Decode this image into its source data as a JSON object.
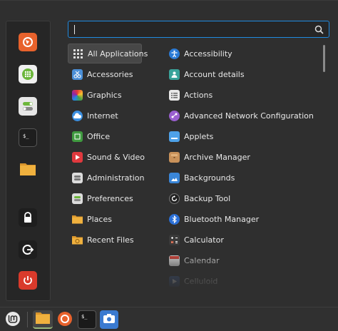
{
  "search": {
    "value": "",
    "placeholder": ""
  },
  "sidebar": {
    "items": [
      {
        "icon": "firefox-icon",
        "color": "#e8622c"
      },
      {
        "icon": "software-manager-icon",
        "color": "#6cb63a"
      },
      {
        "icon": "settings-toggle-icon",
        "color": "#e6e6e6"
      },
      {
        "icon": "terminal-icon",
        "color": "#222222"
      },
      {
        "icon": "folder-icon",
        "color": "#f0b13e"
      },
      {
        "icon": "lock-icon",
        "color": "#222222"
      },
      {
        "icon": "logout-icon",
        "color": "#222222"
      },
      {
        "icon": "power-icon",
        "color": "#d93a2b"
      }
    ]
  },
  "categories": [
    {
      "label": "All Applications",
      "icon": "grid-icon",
      "active": true
    },
    {
      "label": "Accessories",
      "icon": "scissors-icon"
    },
    {
      "label": "Graphics",
      "icon": "graphics-icon"
    },
    {
      "label": "Internet",
      "icon": "cloud-icon"
    },
    {
      "label": "Office",
      "icon": "office-icon"
    },
    {
      "label": "Sound & Video",
      "icon": "play-icon"
    },
    {
      "label": "Administration",
      "icon": "admin-icon"
    },
    {
      "label": "Preferences",
      "icon": "preferences-icon"
    },
    {
      "label": "Places",
      "icon": "folder-icon"
    },
    {
      "label": "Recent Files",
      "icon": "folder-icon"
    }
  ],
  "apps": [
    {
      "label": "Accessibility",
      "icon": "accessibility-icon"
    },
    {
      "label": "Account details",
      "icon": "account-icon"
    },
    {
      "label": "Actions",
      "icon": "actions-icon"
    },
    {
      "label": "Advanced Network Configuration",
      "icon": "network-icon"
    },
    {
      "label": "Applets",
      "icon": "applets-icon"
    },
    {
      "label": "Archive Manager",
      "icon": "archive-icon"
    },
    {
      "label": "Backgrounds",
      "icon": "backgrounds-icon"
    },
    {
      "label": "Backup Tool",
      "icon": "backup-icon"
    },
    {
      "label": "Bluetooth Manager",
      "icon": "bluetooth-icon"
    },
    {
      "label": "Calculator",
      "icon": "calculator-icon"
    },
    {
      "label": "Calendar",
      "icon": "calendar-icon"
    },
    {
      "label": "Celluloid",
      "icon": "celluloid-icon"
    }
  ],
  "taskbar": {
    "items": [
      {
        "icon": "mint-menu-icon"
      },
      {
        "icon": "files-icon",
        "active": true
      },
      {
        "icon": "firefox-icon"
      },
      {
        "icon": "terminal-icon"
      },
      {
        "icon": "screenshot-icon"
      }
    ]
  },
  "colors": {
    "accent": "#1f8ae0",
    "panel": "#2f2f2f",
    "sidebar": "#262626"
  }
}
